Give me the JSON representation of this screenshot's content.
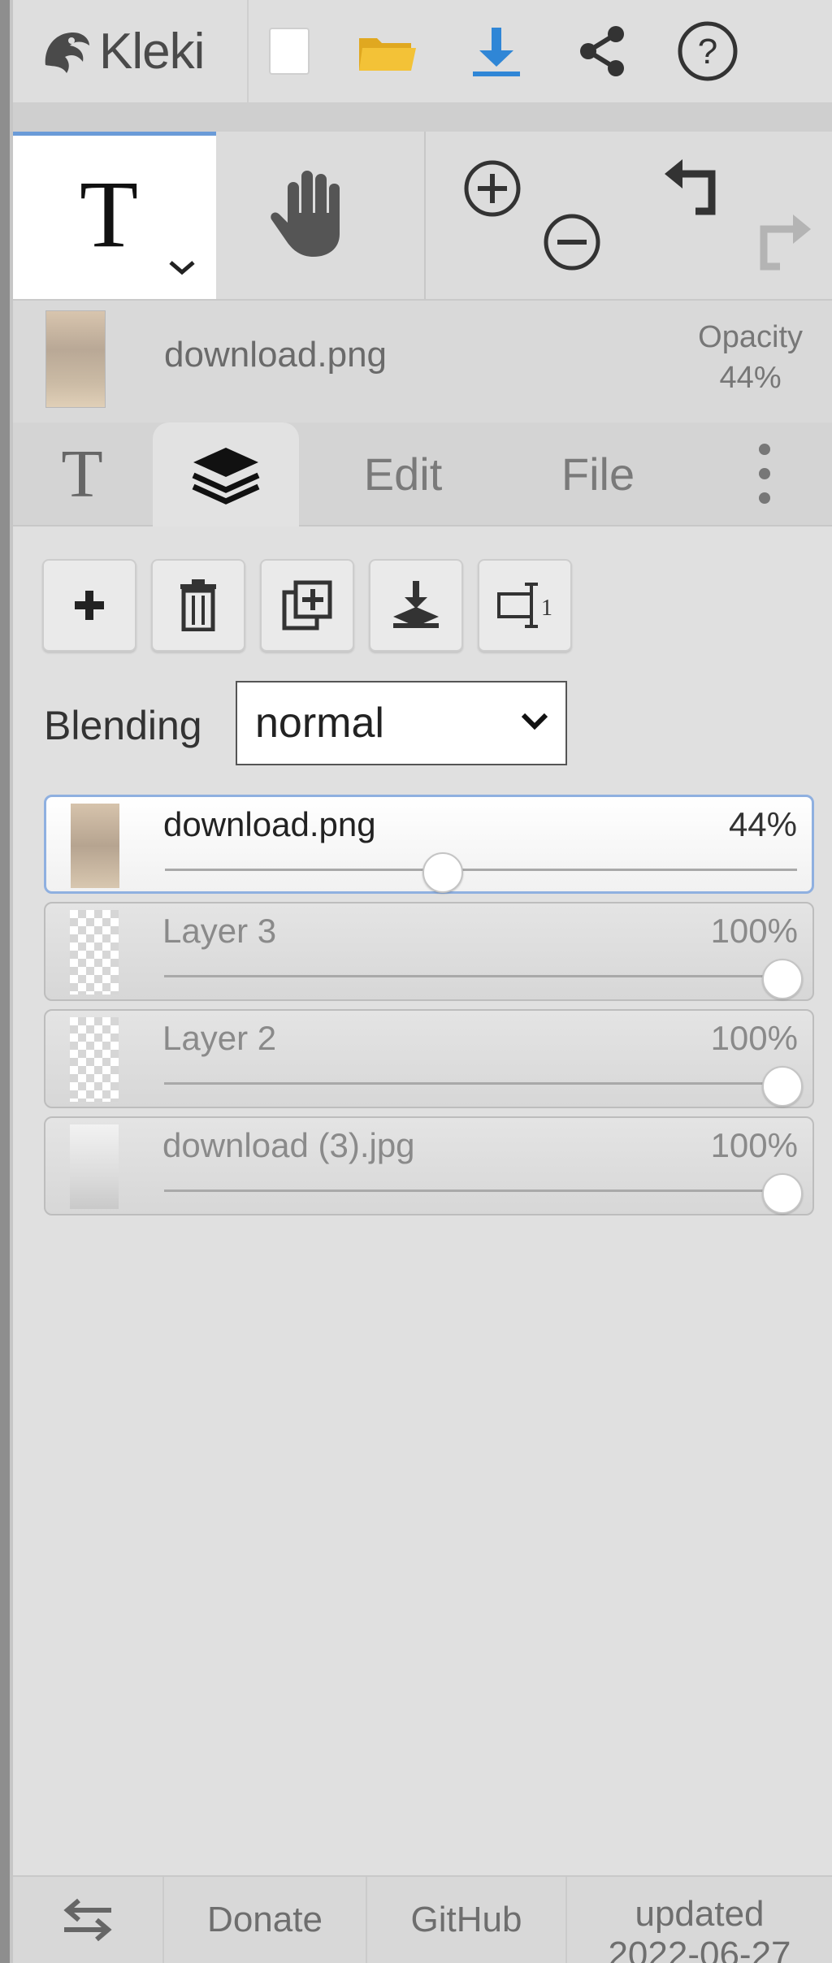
{
  "app": {
    "logo_text": "Kleki"
  },
  "toolbar": {
    "new_label": "New image",
    "open_label": "Open image",
    "save_label": "Save",
    "share_label": "Share",
    "help_label": "Help"
  },
  "tools": {
    "active_tool": "T"
  },
  "layer_info": {
    "name": "download.png",
    "opacity_label": "Opacity",
    "opacity_value": "44%"
  },
  "tabs": [
    {
      "label": "T"
    },
    {
      "label": ""
    },
    {
      "label": "Edit"
    },
    {
      "label": "File"
    }
  ],
  "blending": {
    "label": "Blending",
    "value": "normal"
  },
  "layers": [
    {
      "name": "download.png",
      "opacity_text": "44%",
      "opacity": 0.44,
      "selected": true,
      "thumb": "skin"
    },
    {
      "name": "Layer 3",
      "opacity_text": "100%",
      "opacity": 1.0,
      "selected": false,
      "thumb": "checker"
    },
    {
      "name": "Layer 2",
      "opacity_text": "100%",
      "opacity": 1.0,
      "selected": false,
      "thumb": "checker"
    },
    {
      "name": "download (3).jpg",
      "opacity_text": "100%",
      "opacity": 1.0,
      "selected": false,
      "thumb": "photo"
    }
  ],
  "footer": {
    "donate": "Donate",
    "github": "GitHub",
    "updated_label": "updated",
    "updated_date": "2022-06-27"
  },
  "colors": {
    "accent": "#2f86d6",
    "folder": "#f3c237",
    "selection_border": "#8fb0e0"
  }
}
